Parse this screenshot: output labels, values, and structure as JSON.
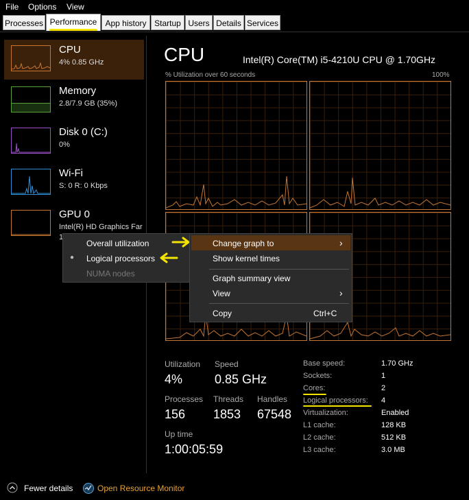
{
  "menubar": {
    "file": "File",
    "options": "Options",
    "view": "View"
  },
  "tabs": [
    "Processes",
    "Performance",
    "App history",
    "Startup",
    "Users",
    "Details",
    "Services"
  ],
  "sidebar": {
    "items": [
      {
        "title": "CPU",
        "sub": "4%  0.85 GHz",
        "color": "#c77732"
      },
      {
        "title": "Memory",
        "sub": "2.8/7.9 GB (35%)",
        "color": "#5aa33c"
      },
      {
        "title": "Disk 0 (C:)",
        "sub": "0%",
        "color": "#9b4fc9"
      },
      {
        "title": "Wi-Fi",
        "sub": "S: 0  R: 0 Kbps",
        "color": "#2f8fd6"
      },
      {
        "title": "GPU 0",
        "sub": "Intel(R) HD Graphics Far",
        "sub2": "1",
        "color": "#c77732"
      }
    ]
  },
  "main": {
    "title": "CPU",
    "model": "Intel(R) Core(TM) i5-4210U CPU @ 1.70GHz",
    "graph_label": "% Utilization over 60 seconds",
    "graph_max": "100%"
  },
  "stats": {
    "utilization_label": "Utilization",
    "utilization": "4%",
    "speed_label": "Speed",
    "speed": "0.85 GHz",
    "processes_label": "Processes",
    "processes": "156",
    "threads_label": "Threads",
    "threads": "1853",
    "handles_label": "Handles",
    "handles": "67548",
    "uptime_label": "Up time",
    "uptime": "1:00:05:59"
  },
  "specs": [
    {
      "label": "Base speed:",
      "value": "1.70 GHz"
    },
    {
      "label": "Sockets:",
      "value": "1"
    },
    {
      "label": "Cores:",
      "value": "2"
    },
    {
      "label": "Logical processors:",
      "value": "4"
    },
    {
      "label": "Virtualization:",
      "value": "Enabled"
    },
    {
      "label": "L1 cache:",
      "value": "128 KB"
    },
    {
      "label": "L2 cache:",
      "value": "512 KB"
    },
    {
      "label": "L3 cache:",
      "value": "3.0 MB"
    }
  ],
  "submenu": {
    "overall": "Overall utilization",
    "logical": "Logical processors",
    "numa": "NUMA nodes",
    "bullet": "●"
  },
  "context_menu": {
    "change_graph": "Change graph to",
    "kernel": "Show kernel times",
    "summary": "Graph summary view",
    "view": "View",
    "copy": "Copy",
    "copy_shortcut": "Ctrl+C",
    "arrow": "›"
  },
  "footer": {
    "fewer": "Fewer details",
    "monitor": "Open Resource Monitor"
  },
  "colors": {
    "accent": "#c77732",
    "highlight": "#5a3513",
    "annotation": "#f5e400",
    "link": "#e5a23a"
  }
}
